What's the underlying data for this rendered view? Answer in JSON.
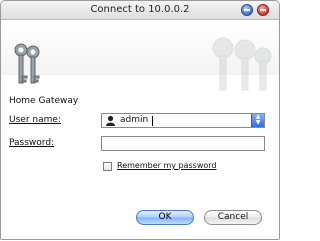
{
  "window": {
    "title": "Connect to 10.0.0.2"
  },
  "titlebar_buttons": [
    {
      "name": "minimize",
      "icon": "minimize-icon"
    },
    {
      "name": "close",
      "icon": "close-icon"
    }
  ],
  "banner": {
    "icon": "keys-icon",
    "watermark_icon": "keys-icon"
  },
  "form": {
    "heading": "Home Gateway",
    "username_label": "User name:",
    "username_value": "admin",
    "password_label": "Password:",
    "password_value": "",
    "remember_label": "Remember my password",
    "remember_checked": false
  },
  "buttons": {
    "ok": "OK",
    "cancel": "Cancel"
  },
  "colors": {
    "accent": "#3a6fd8",
    "close": "#d8352a"
  }
}
